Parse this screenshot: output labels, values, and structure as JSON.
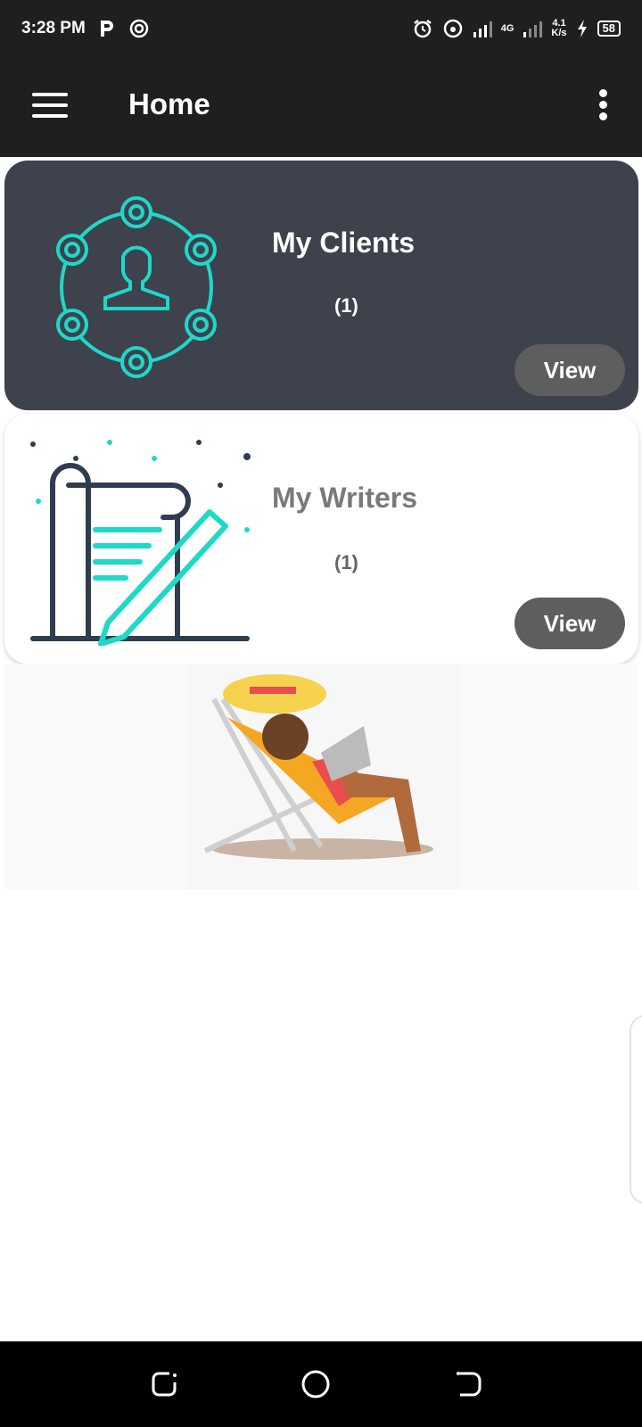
{
  "status_bar": {
    "time": "3:28 PM",
    "net_type": "4G",
    "net_speed_value": "4.1",
    "net_speed_unit": "K/s",
    "battery": "58"
  },
  "app_bar": {
    "title": "Home"
  },
  "cards": [
    {
      "title": "My Clients",
      "count": "(1)",
      "button": "View",
      "icon": "clients-network-icon"
    },
    {
      "title": "My Writers",
      "count": "(1)",
      "button": "View",
      "icon": "writer-document-icon"
    }
  ],
  "illustration": "beach-laptop-illustration",
  "colors": {
    "bar_bg": "#1f1f1f",
    "clients_card_bg": "#3d424d",
    "accent_teal": "#1fd8c8",
    "button_bg": "#5e5e5e"
  }
}
